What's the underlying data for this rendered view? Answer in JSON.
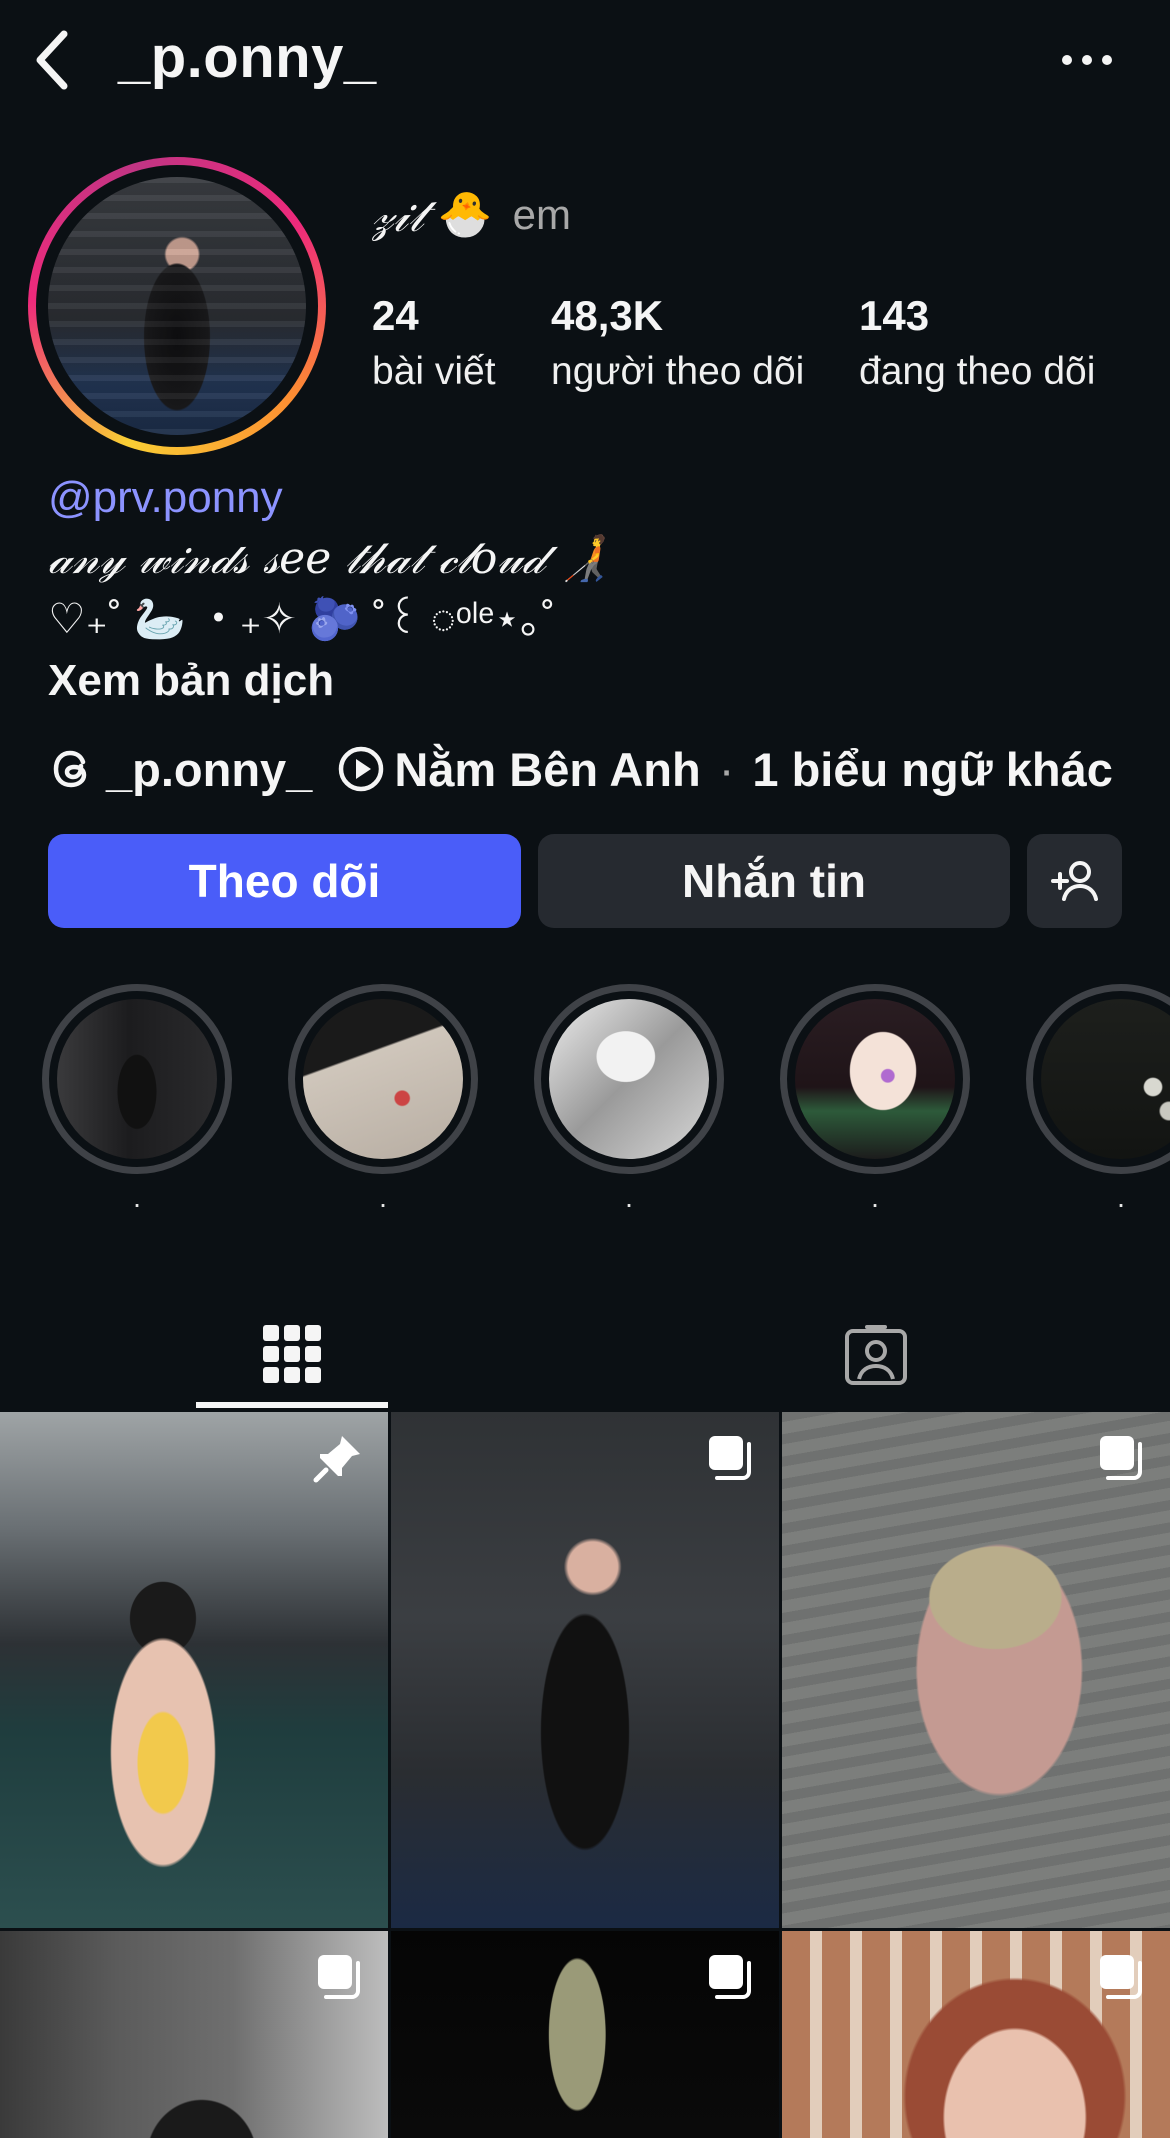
{
  "header": {
    "username": "_p.onny_"
  },
  "profile": {
    "display_name": "𝓏𝒾𝓉",
    "display_emoji": "🐣",
    "pronoun": "em",
    "stats": [
      {
        "value": "24",
        "label": "bài viết"
      },
      {
        "value": "48,3K",
        "label": "người theo dõi"
      },
      {
        "value": "143",
        "label": "đang theo dõi"
      }
    ],
    "handle": "@prv.ponny",
    "bio_line1": "𝒶𝓃𝓎 𝓌𝒾𝓃𝒹𝓈 𝓈𝑒𝑒 𝓉𝒽𝒶𝓉 𝒸𝓁𝑜𝓊𝒹 🧑‍🦯",
    "bio_line2": "♡₊˚ 🦢 ・₊✧ 🫐 ˚꒰ ◌ᵒˡᵉ⋆｡˚",
    "translate": "Xem bản dịch"
  },
  "links": {
    "threads": "_p.onny_",
    "music": "Nằm Bên Anh",
    "more": "1 biểu ngữ khác"
  },
  "buttons": {
    "follow": "Theo dõi",
    "message": "Nhắn tin"
  },
  "highlights": [
    {
      "label": "."
    },
    {
      "label": "."
    },
    {
      "label": "."
    },
    {
      "label": "."
    },
    {
      "label": "."
    }
  ],
  "colors": {
    "accent": "#4a5df9",
    "handle": "#8c93ff",
    "background": "#0b1014"
  }
}
